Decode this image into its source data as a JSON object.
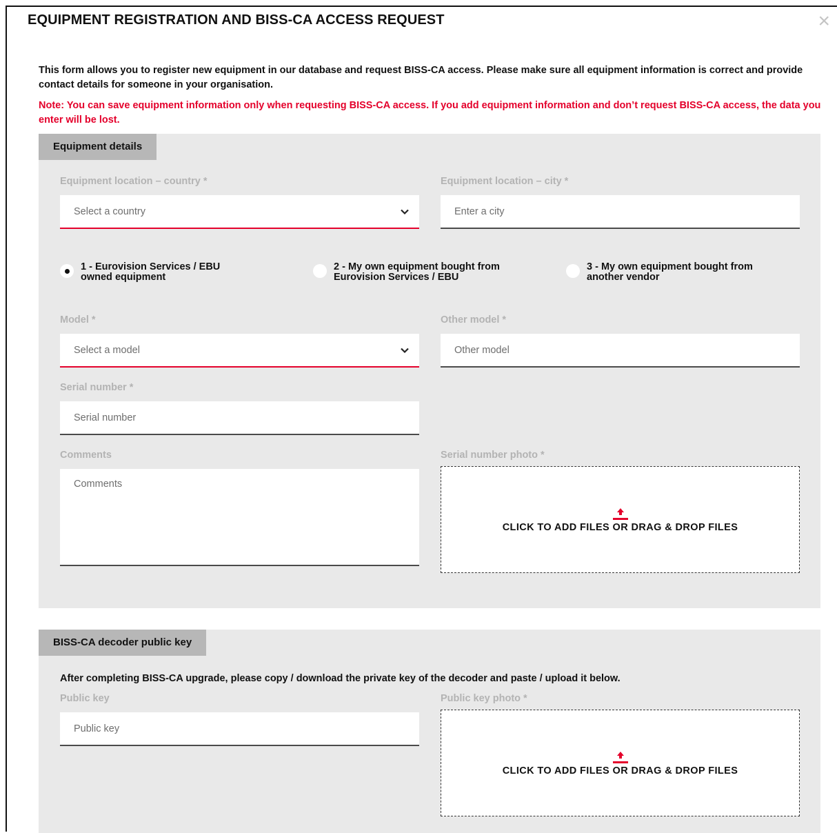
{
  "modal": {
    "title": "EQUIPMENT REGISTRATION AND BISS-CA ACCESS REQUEST",
    "close_icon": "×",
    "intro": "This form allows you to register new equipment in our database and request BISS-CA access. Please make sure all equipment information is correct and provide contact details for someone in your organisation.",
    "note": "Note: You can save equipment information only when requesting BISS-CA access. If you add equipment information and don’t request BISS-CA access, the data you enter will be lost."
  },
  "equipment": {
    "tab": "Equipment details",
    "country_label": "Equipment location – country *",
    "country_value": "Select a country",
    "city_label": "Equipment location – city *",
    "city_placeholder": "Enter a city",
    "radios": [
      {
        "line1": "1 - Eurovision Services / EBU",
        "line2": "owned equipment",
        "selected": true
      },
      {
        "line1": "2 - My own equipment bought from",
        "line2": "Eurovision Services / EBU",
        "selected": false
      },
      {
        "line1": "3 - My own equipment bought from",
        "line2": "another vendor",
        "selected": false
      }
    ],
    "model_label": "Model *",
    "model_value": "Select a model",
    "other_model_label": "Other model *",
    "other_model_placeholder": "Other model",
    "serial_label": "Serial number *",
    "serial_placeholder": "Serial number",
    "comments_label": "Comments",
    "comments_placeholder": "Comments",
    "serial_photo_label": "Serial number photo *",
    "upload_text": "CLICK TO ADD FILES OR DRAG & DROP FILES"
  },
  "decoder": {
    "tab": "BISS-CA decoder public key",
    "helper": "After completing BISS-CA upgrade, please copy / download the private key of the decoder and paste / upload it below.",
    "public_key_label": "Public key",
    "public_key_placeholder": "Public key",
    "public_key_photo_label": "Public key photo *",
    "upload_text": "CLICK TO ADD FILES OR DRAG & DROP FILES"
  },
  "colors": {
    "accent": "#e4002b",
    "panel": "#e9e9e9",
    "tab": "#b7b7b7",
    "label": "#b3b3b3"
  },
  "icons": [
    "close-icon",
    "chevron-down-icon",
    "upload-icon"
  ]
}
